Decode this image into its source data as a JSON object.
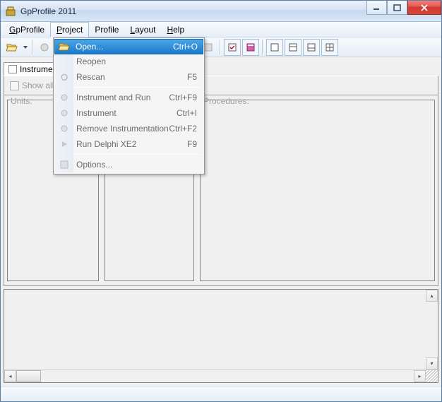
{
  "window": {
    "title": "GpProfile 2011"
  },
  "menubar": [
    {
      "label": "GpProfile",
      "accel": "G"
    },
    {
      "label": "Project",
      "accel": "P"
    },
    {
      "label": "Profile",
      "accel": null
    },
    {
      "label": "Layout",
      "accel": "L"
    },
    {
      "label": "Help",
      "accel": "H"
    }
  ],
  "dropdown": {
    "items": [
      {
        "icon": "folder-open-icon",
        "label": "Open...",
        "shortcut": "Ctrl+O",
        "enabled": true,
        "highlight": true
      },
      {
        "icon": null,
        "label": "Reopen",
        "shortcut": "",
        "enabled": false
      },
      {
        "icon": "refresh-icon",
        "label": "Rescan",
        "shortcut": "F5",
        "enabled": false
      },
      {
        "sep": true
      },
      {
        "icon": "gear-run-icon",
        "label": "Instrument and Run",
        "shortcut": "Ctrl+F9",
        "enabled": false
      },
      {
        "icon": "gear-icon",
        "label": "Instrument",
        "shortcut": "Ctrl+I",
        "enabled": false
      },
      {
        "icon": "gear-remove-icon",
        "label": "Remove Instrumentation",
        "shortcut": "Ctrl+F2",
        "enabled": false
      },
      {
        "icon": "play-icon",
        "label": "Run Delphi XE2",
        "shortcut": "F9",
        "enabled": false
      },
      {
        "sep": true
      },
      {
        "icon": "options-icon",
        "label": "Options...",
        "shortcut": "",
        "enabled": false
      }
    ]
  },
  "tabs": {
    "tab1": "Instrumentation"
  },
  "subbar": {
    "showall": "Show all folders",
    "units": "Units:",
    "procedures": "Procedures:"
  },
  "toolbar_icons": [
    "folder-open-icon",
    "dropdown-arrow-icon",
    "gear-run-icon",
    "gear-icon",
    "gear-remove-icon",
    "refresh-icon",
    "link-add-icon",
    "link-remove-icon",
    "chain-add-icon",
    "chain-remove-icon",
    "grid-icon",
    "checkbox-icon",
    "book-icon",
    "panel-single-icon",
    "panel-split-h-icon",
    "panel-split-v-icon",
    "panel-grid-icon"
  ]
}
